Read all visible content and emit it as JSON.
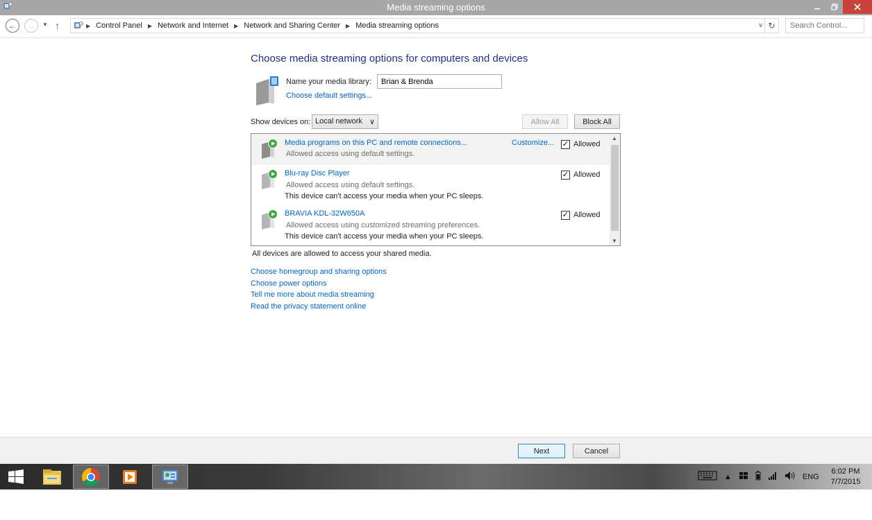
{
  "window": {
    "title": "Media streaming options"
  },
  "address": {
    "crumbs": [
      "Control Panel",
      "Network and Internet",
      "Network and Sharing Center",
      "Media streaming options"
    ],
    "search_placeholder": "Search Control..."
  },
  "page": {
    "heading": "Choose media streaming options for computers and devices",
    "library_label": "Name your media library:",
    "library_value": "Brian & Brenda",
    "defaults_link": "Choose default settings...",
    "show_devices_label": "Show devices on:",
    "network_selected": "Local network",
    "allow_all": "Allow All",
    "block_all": "Block All",
    "devices": [
      {
        "name": "Media programs on this PC and remote connections...",
        "status": "Allowed access using default settings.",
        "note": "",
        "customize": "Customize...",
        "checked": true,
        "allowed_label": "Allowed"
      },
      {
        "name": "Blu-ray Disc Player",
        "status": "Allowed access using default settings.",
        "note": "This device can't access your media when your PC sleeps.",
        "customize": "",
        "checked": true,
        "allowed_label": "Allowed"
      },
      {
        "name": "BRAVIA KDL-32W650A",
        "status": "Allowed access using customized streaming preferences.",
        "note": "This device can't access your media when your PC sleeps.",
        "customize": "",
        "checked": true,
        "allowed_label": "Allowed"
      }
    ],
    "status_text": "All devices are allowed to access your shared media.",
    "links": [
      "Choose homegroup and sharing options",
      "Choose power options",
      "Tell me more about media streaming",
      "Read the privacy statement online"
    ]
  },
  "footer": {
    "next": "Next",
    "cancel": "Cancel"
  },
  "taskbar": {
    "apps": [
      "start-icon",
      "file-explorer-icon",
      "chrome-icon",
      "media-player-icon",
      "control-panel-icon"
    ],
    "language": "ENG",
    "time": "6:02 PM",
    "date": "7/7/2015"
  },
  "colors": {
    "link": "#0066cc",
    "heading": "#1e3287",
    "titlebar": "#a7a7a7",
    "close": "#c7423a"
  }
}
